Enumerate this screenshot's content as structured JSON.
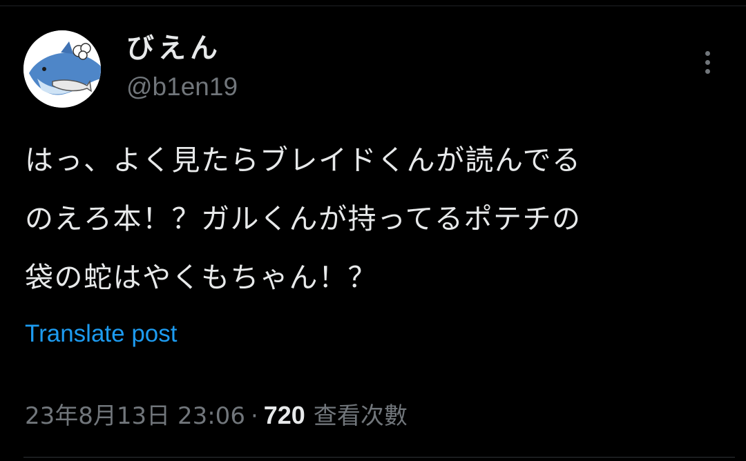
{
  "author": {
    "display_name": "びえん",
    "handle": "@b1en19",
    "avatar_icon": "shark-icon"
  },
  "post": {
    "text_lines": [
      "はっ、よく見たらブレイドくんが読んでる",
      "のえろ本！？ガルくんが持ってるポテチの",
      "袋の蛇はやくもちゃん！？"
    ],
    "translate_label": "Translate post"
  },
  "meta": {
    "timestamp": "23年8月13日 23:06",
    "separator": "·",
    "views_count": "720",
    "views_label": "查看次數"
  },
  "more_icon": "more-vertical-icon",
  "colors": {
    "background": "#000000",
    "primary_text": "#e7e9ea",
    "secondary_text": "#71767b",
    "link": "#1d9bf0"
  }
}
